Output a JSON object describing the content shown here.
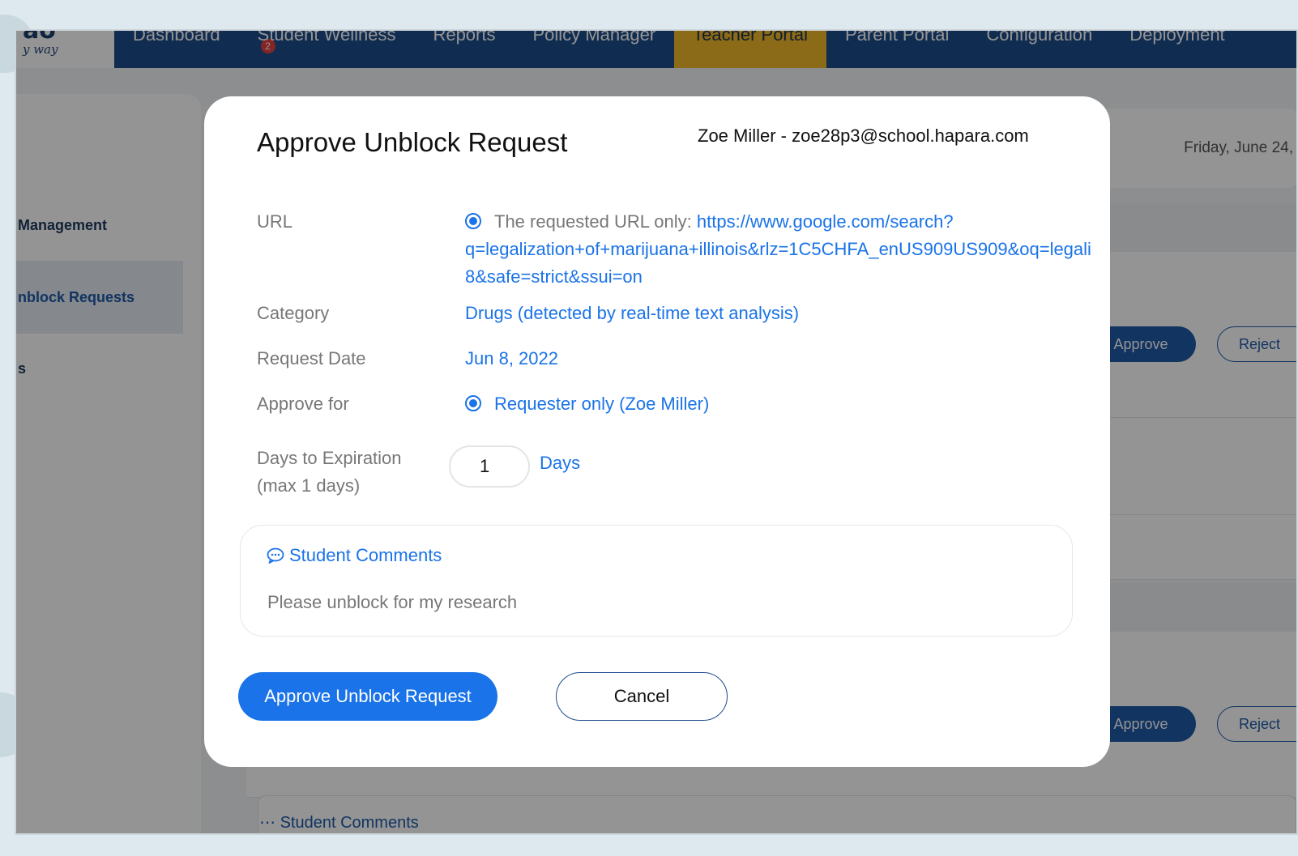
{
  "app": {
    "logo_text": "ao",
    "logo_tagline": "y way"
  },
  "nav": {
    "items": [
      {
        "label": "Dashboard"
      },
      {
        "label": "Student Wellness",
        "badge": "2"
      },
      {
        "label": "Reports"
      },
      {
        "label": "Policy Manager"
      },
      {
        "label": "Teacher Portal",
        "active": true
      },
      {
        "label": "Parent Portal"
      },
      {
        "label": "Configuration"
      },
      {
        "label": "Deployment"
      }
    ]
  },
  "sidebar": {
    "items": [
      {
        "label": "Management"
      },
      {
        "label": "nblock Requests",
        "active": true
      },
      {
        "label": "s"
      }
    ]
  },
  "background": {
    "date": "Friday, June 24,",
    "approve_label": "Approve",
    "reject_label": "Reject",
    "comments_label": "Student Comments"
  },
  "modal": {
    "title": "Approve Unblock Request",
    "user": "Zoe Miller - zoe28p3@school.hapara.com",
    "url": {
      "label": "URL",
      "prefix": "The requested URL only:",
      "line1": "https://www.google.com/search?",
      "line2": "q=legalization+of+marijuana+illinois&rlz=1C5CHFA_enUS909US909&oq=legali",
      "line3": "8&safe=strict&ssui=on"
    },
    "category": {
      "label": "Category",
      "value": "Drugs (detected by real-time text analysis)"
    },
    "request_date": {
      "label": "Request Date",
      "value": "Jun 8, 2022"
    },
    "approve_for": {
      "label": "Approve for",
      "value": "Requester only (Zoe Miller)"
    },
    "expiration": {
      "label_line1": "Days to Expiration",
      "label_line2": "(max 1 days)",
      "value": "1",
      "unit": "Days"
    },
    "comments": {
      "title": "Student Comments",
      "text": "Please unblock for my research"
    },
    "approve_button": "Approve Unblock Request",
    "cancel_button": "Cancel"
  },
  "colors": {
    "nav_bg": "#1e4d8c",
    "nav_active": "#f0b928",
    "accent": "#1a73e8",
    "overlay": "rgba(0,0,0,0.42)"
  }
}
